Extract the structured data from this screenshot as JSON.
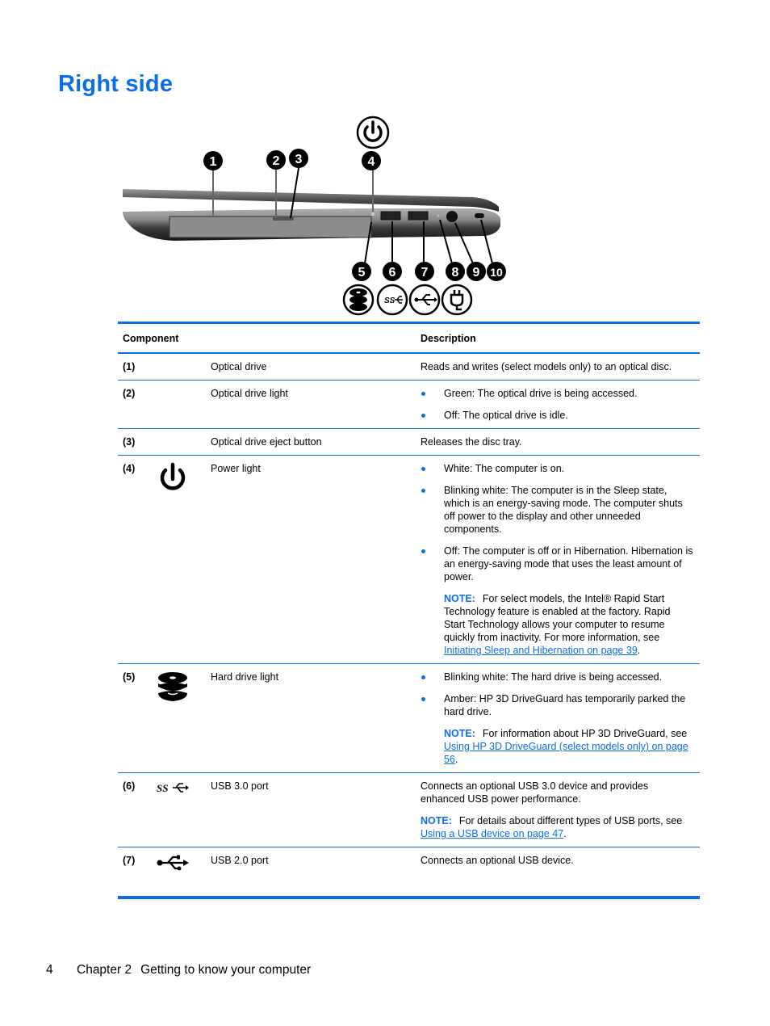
{
  "page": {
    "title": "Right side",
    "footer": {
      "page_number": "4",
      "chapter": "Chapter 2",
      "chapter_title": "Getting to know your computer"
    }
  },
  "illustration": {
    "callouts_top": [
      "1",
      "2",
      "3",
      "4"
    ],
    "callouts_bottom": [
      "5",
      "6",
      "7",
      "8",
      "9",
      "10"
    ],
    "top_icons": [
      "power-icon"
    ],
    "bottom_icons": [
      "hard-drive-icon",
      "usb-3-ss-icon",
      "usb-icon",
      "power-plug-icon"
    ]
  },
  "table": {
    "headers": {
      "component": "Component",
      "description": "Description"
    },
    "rows": [
      {
        "num": "(1)",
        "icon": null,
        "name": "Optical drive",
        "text": "Reads and writes (select models only) to an optical disc."
      },
      {
        "num": "(2)",
        "icon": null,
        "name": "Optical drive light",
        "bullets": [
          "Green: The optical drive is being accessed.",
          "Off: The optical drive is idle."
        ]
      },
      {
        "num": "(3)",
        "icon": null,
        "name": "Optical drive eject button",
        "text": "Releases the disc tray."
      },
      {
        "num": "(4)",
        "icon": "power-icon",
        "name": "Power light",
        "bullets": [
          "White: The computer is on.",
          "Blinking white: The computer is in the Sleep state, which is an energy-saving mode. The computer shuts off power to the display and other unneeded components.",
          "Off: The computer is off or in Hibernation. Hibernation is an energy-saving mode that uses the least amount of power."
        ],
        "note": {
          "label": "NOTE:",
          "text": "For select models, the Intel® Rapid Start Technology feature is enabled at the factory. Rapid Start Technology allows your computer to resume quickly from inactivity. For more information, see ",
          "link": "Initiating Sleep and Hibernation on page 39",
          "after": "."
        }
      },
      {
        "num": "(5)",
        "icon": "hard-drive-icon",
        "name": "Hard drive light",
        "bullets": [
          "Blinking white: The hard drive is being accessed.",
          "Amber: HP 3D DriveGuard has temporarily parked the hard drive."
        ],
        "note": {
          "label": "NOTE:",
          "text": "For information about HP 3D DriveGuard, see ",
          "link": "Using HP 3D DriveGuard (select models only) on page 56",
          "after": "."
        }
      },
      {
        "num": "(6)",
        "icon": "usb-3-ss-icon",
        "name": "USB 3.0 port",
        "text": "Connects an optional USB 3.0 device and provides enhanced USB power performance.",
        "note": {
          "label": "NOTE:",
          "text": "For details about different types of USB ports, see ",
          "link": "Using a USB device on page 47",
          "after": "."
        }
      },
      {
        "num": "(7)",
        "icon": "usb-icon",
        "name": "USB 2.0 port",
        "text": "Connects an optional USB device."
      }
    ]
  },
  "colors": {
    "accent": "#0b6ee6",
    "text": "#000000"
  }
}
